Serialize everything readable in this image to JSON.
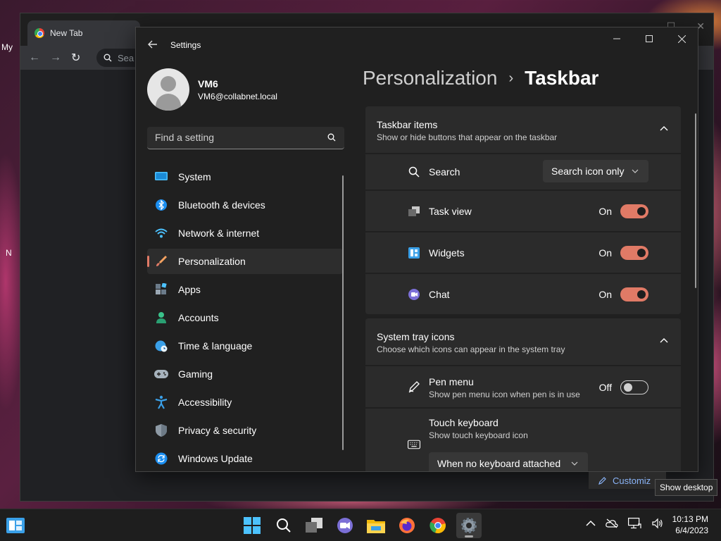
{
  "desktop": {
    "label_top": "My",
    "label_mid": "N"
  },
  "chrome": {
    "tab_title": "New Tab",
    "omnibox_placeholder": "Sea"
  },
  "settings": {
    "app_title": "Settings",
    "user": {
      "name": "VM6",
      "email": "VM6@collabnet.local"
    },
    "search_placeholder": "Find a setting",
    "nav": [
      {
        "label": "System",
        "icon": "system-icon"
      },
      {
        "label": "Bluetooth & devices",
        "icon": "bluetooth-icon"
      },
      {
        "label": "Network & internet",
        "icon": "wifi-icon"
      },
      {
        "label": "Personalization",
        "icon": "brush-icon",
        "active": true
      },
      {
        "label": "Apps",
        "icon": "apps-icon"
      },
      {
        "label": "Accounts",
        "icon": "accounts-icon"
      },
      {
        "label": "Time & language",
        "icon": "globe-clock-icon"
      },
      {
        "label": "Gaming",
        "icon": "gamepad-icon"
      },
      {
        "label": "Accessibility",
        "icon": "accessibility-icon"
      },
      {
        "label": "Privacy & security",
        "icon": "shield-icon"
      },
      {
        "label": "Windows Update",
        "icon": "update-icon"
      }
    ],
    "breadcrumb": {
      "parent": "Personalization",
      "separator": "›",
      "current": "Taskbar"
    },
    "taskbar_items": {
      "title": "Taskbar items",
      "subtitle": "Show or hide buttons that appear on the taskbar",
      "search": {
        "label": "Search",
        "value": "Search icon only"
      },
      "task_view": {
        "label": "Task view",
        "state": "On"
      },
      "widgets": {
        "label": "Widgets",
        "state": "On"
      },
      "chat": {
        "label": "Chat",
        "state": "On"
      }
    },
    "system_tray": {
      "title": "System tray icons",
      "subtitle": "Choose which icons can appear in the system tray",
      "pen_menu": {
        "label": "Pen menu",
        "sub": "Show pen menu icon when pen is in use",
        "state": "Off"
      },
      "touch_keyboard": {
        "label": "Touch keyboard",
        "sub": "Show touch keyboard icon",
        "value": "When no keyboard attached"
      }
    },
    "accent_color": "#e07a66"
  },
  "customize_link": "Customiz",
  "tooltip": "Show desktop",
  "taskbar": {
    "apps": [
      "start-icon",
      "search-icon",
      "task-view-icon",
      "chat-icon",
      "file-explorer-icon",
      "firefox-icon",
      "chrome-icon",
      "settings-icon"
    ],
    "clock": {
      "time": "10:13 PM",
      "date": "6/4/2023"
    }
  }
}
